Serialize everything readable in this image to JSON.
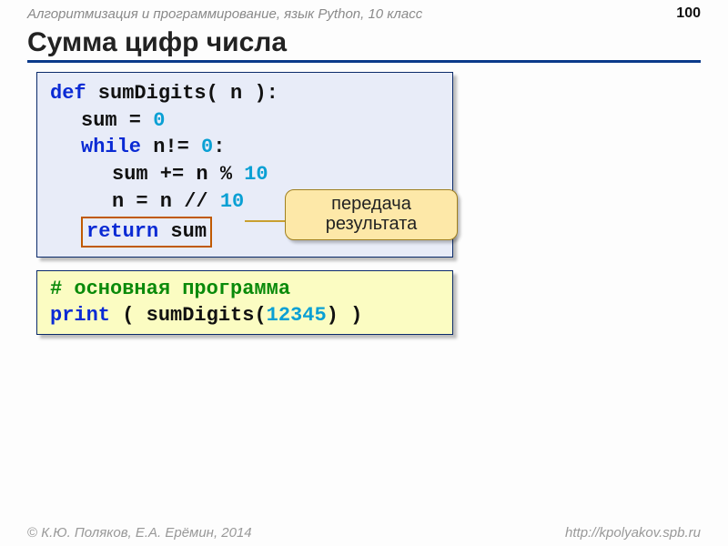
{
  "header": {
    "subject": "Алгоритмизация и программирование, язык Python, 10 класс",
    "page": "100"
  },
  "title": "Сумма цифр числа",
  "code1": {
    "l1_def": "def",
    "l1_rest": " sumDigits( n ):",
    "l2_a": "sum = ",
    "l2_zero": "0",
    "l3_while": "while",
    "l3_cond": " n!= ",
    "l3_zero": "0",
    "l3_colon": ":",
    "l4": "sum += n % ",
    "l4_ten": "10",
    "l5": "n = n // ",
    "l5_ten": "10",
    "l6_ret": "return",
    "l6_var": " sum"
  },
  "callout": {
    "line1": "передача",
    "line2": "результата"
  },
  "code2": {
    "comment": "# основная программа",
    "print_kw": "print",
    "call_open": " ( sumDigits(",
    "arg": "12345",
    "call_close": ") )"
  },
  "footer": {
    "authors": "К.Ю. Поляков, Е.А. Ерёмин, 2014",
    "url": "http://kpolyakov.spb.ru"
  }
}
